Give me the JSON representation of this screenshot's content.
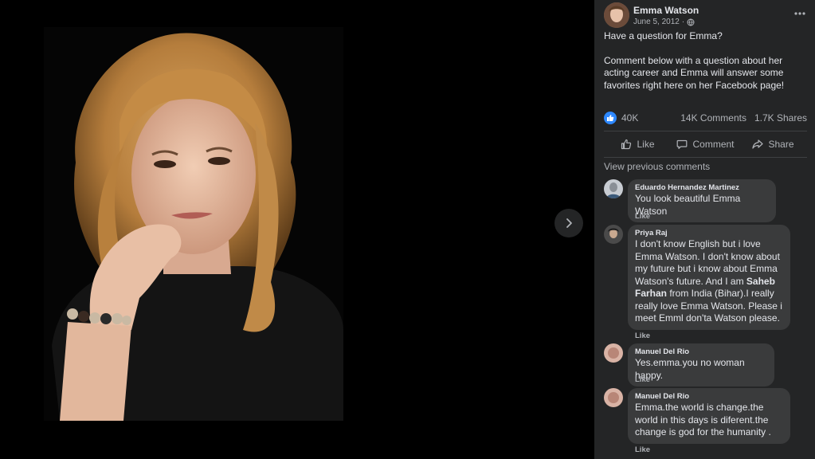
{
  "viewer": {
    "next_icon": "chevron-right-icon"
  },
  "post": {
    "page_name": "Emma Watson",
    "date": "June 5, 2012",
    "privacy_icon": "globe-icon",
    "more_icon": "more-horizontal-icon",
    "text_line1": "Have a question for Emma?",
    "text_line2": "Comment below with a question about her acting career and Emma will answer some favorites right here on her Facebook page!"
  },
  "stats": {
    "reactions": "40K",
    "comments": "14K Comments",
    "shares": "1.7K Shares"
  },
  "actions": {
    "like": "Like",
    "comment": "Comment",
    "share": "Share"
  },
  "view_previous": "View previous comments",
  "comments": [
    {
      "name": "Eduardo Hernandez Martinez",
      "text": "You look beautiful Emma Watson",
      "like": "Like"
    },
    {
      "name": "Priya Raj",
      "text_a": "I don't know English but i love Emma Watson. I don't know about my future but i know about Emma Watson's future. And I am ",
      "text_bold": "Saheb Farhan",
      "text_b": " from India (Bihar).I really really love Emma Watson. Please i meet Emml don'ta Watson please.",
      "like": "Like"
    },
    {
      "name": "Manuel Del Rio",
      "text": "Yes.emma.you no woman happy.",
      "like": "Like"
    },
    {
      "name": "Manuel Del Rio",
      "text": "Emma.the world is change.the world in this days is diferent.the change is god for the humanity .",
      "like": "Like"
    }
  ],
  "colors": {
    "panel_bg": "#242526",
    "bubble_bg": "#3a3b3c",
    "text_primary": "#e4e6eb",
    "text_secondary": "#b0b3b8",
    "like_blue": "#2d88ff"
  }
}
